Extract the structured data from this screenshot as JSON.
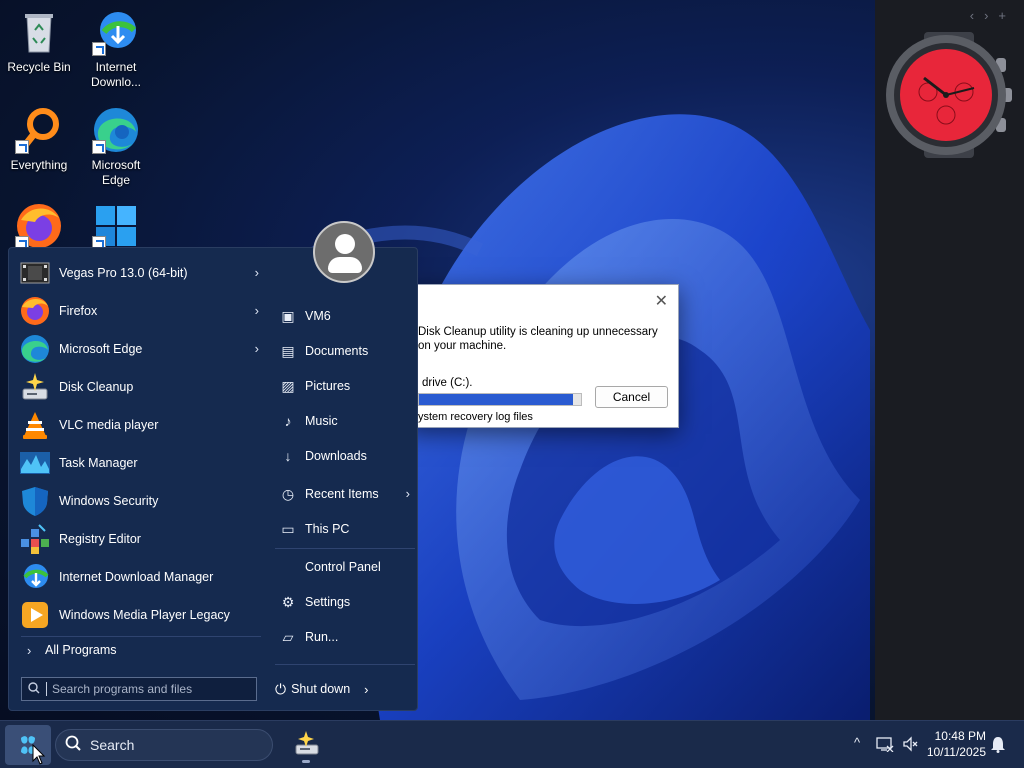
{
  "desktop": {
    "icons": [
      {
        "label": "Recycle Bin",
        "icon": "recycle-bin-icon"
      },
      {
        "label": "Internet Downlo...",
        "icon": "internet-download-manager-icon"
      },
      {
        "label": "Everything",
        "icon": "everything-search-icon"
      },
      {
        "label": "Microsoft Edge",
        "icon": "microsoft-edge-icon"
      },
      {
        "label": "",
        "icon": "firefox-icon"
      },
      {
        "label": "",
        "icon": "windows-logo-icon"
      }
    ]
  },
  "side_panel": {
    "nav": {
      "prev": "‹",
      "next": "›",
      "add": "+"
    },
    "widget": "analog-watch"
  },
  "dialog": {
    "message": "Disk Cleanup utility is cleaning up unnecessary on your machine.",
    "drive": "drive  (C:).",
    "progress": 0.95,
    "status": "ystem recovery log files",
    "cancel_label": "Cancel",
    "close_glyph": "✕"
  },
  "start_menu": {
    "pinned": [
      {
        "label": "Vegas Pro 13.0 (64-bit)",
        "has_submenu": true,
        "icon": "vegas-pro-icon"
      },
      {
        "label": "Firefox",
        "has_submenu": true,
        "icon": "firefox-icon"
      },
      {
        "label": "Microsoft Edge",
        "has_submenu": true,
        "icon": "microsoft-edge-icon"
      },
      {
        "label": "Disk Cleanup",
        "has_submenu": false,
        "icon": "disk-cleanup-icon"
      },
      {
        "label": "VLC media player",
        "has_submenu": false,
        "icon": "vlc-icon"
      },
      {
        "label": "Task Manager",
        "has_submenu": false,
        "icon": "task-manager-icon"
      },
      {
        "label": "Windows Security",
        "has_submenu": false,
        "icon": "windows-security-icon"
      },
      {
        "label": "Registry Editor",
        "has_submenu": false,
        "icon": "registry-editor-icon"
      },
      {
        "label": "Internet Download Manager",
        "has_submenu": false,
        "icon": "internet-download-manager-icon"
      },
      {
        "label": "Windows Media Player Legacy",
        "has_submenu": false,
        "icon": "media-player-icon"
      }
    ],
    "all_programs": "All Programs",
    "places": [
      {
        "label": "VM6",
        "icon": "user-folder-icon",
        "glyph": "▣"
      },
      {
        "label": "Documents",
        "icon": "document-icon",
        "glyph": "▤"
      },
      {
        "label": "Pictures",
        "icon": "picture-icon",
        "glyph": "▨"
      },
      {
        "label": "Music",
        "icon": "music-note-icon",
        "glyph": "♪"
      },
      {
        "label": "Downloads",
        "icon": "download-arrow-icon",
        "glyph": "↓"
      },
      {
        "label": "Recent Items",
        "icon": "clock-icon",
        "glyph": "◷",
        "has_submenu": true
      },
      {
        "label": "This PC",
        "icon": "computer-icon",
        "glyph": "▭"
      },
      {
        "label": "Control Panel",
        "icon": "control-panel-icon",
        "glyph": ""
      },
      {
        "label": "Settings",
        "icon": "gear-icon",
        "glyph": "⚙"
      },
      {
        "label": "Run...",
        "icon": "run-icon",
        "glyph": "▱"
      }
    ],
    "search_placeholder": "Search programs and files",
    "shutdown_label": "Shut down"
  },
  "taskbar": {
    "search_label": "Search",
    "tray": {
      "chevron": "^"
    },
    "time": "10:48 PM",
    "date": "10/11/2025"
  }
}
